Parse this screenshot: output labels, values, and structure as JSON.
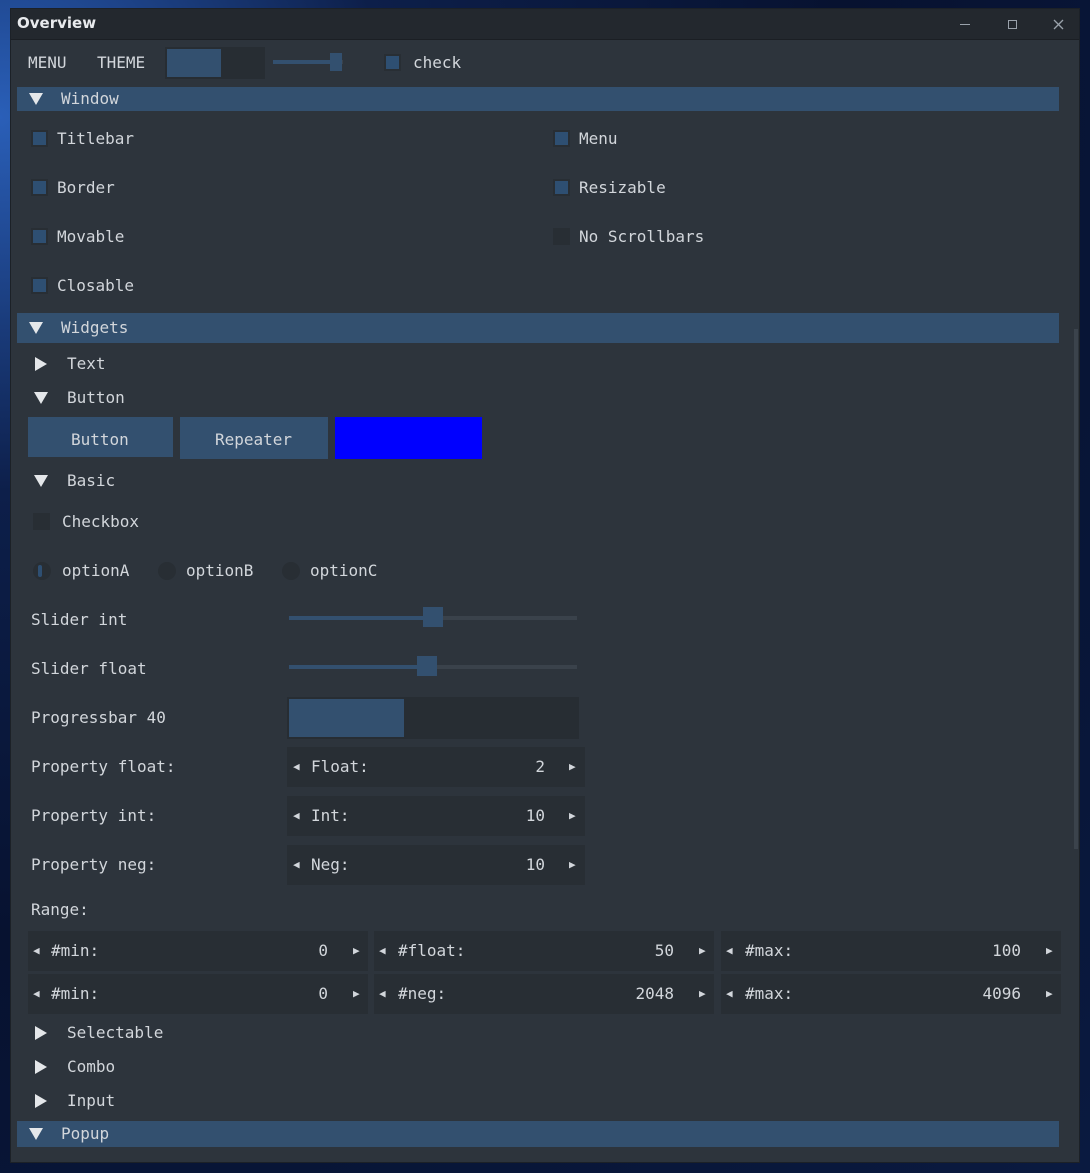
{
  "window": {
    "title": "Overview"
  },
  "menubar": {
    "menu": "MENU",
    "theme": "THEME",
    "check": "check",
    "slider_level": 0.9
  },
  "sections": {
    "window": "Window",
    "widgets": "Widgets",
    "popup": "Popup"
  },
  "window_flags": {
    "titlebar": "Titlebar",
    "menu": "Menu",
    "border": "Border",
    "resizable": "Resizable",
    "movable": "Movable",
    "no_scrollbars": "No Scrollbars",
    "closable": "Closable"
  },
  "widgets": {
    "text": "Text",
    "button_group": "Button",
    "buttons": {
      "button": "Button",
      "repeater": "Repeater",
      "color": "#0000ff"
    },
    "basic": "Basic",
    "checkbox": "Checkbox",
    "options": [
      "optionA",
      "optionB",
      "optionC"
    ],
    "slider_int_label": "Slider int",
    "slider_int_level": 0.5,
    "slider_float_label": "Slider float",
    "slider_float_level": 0.48,
    "progress_label": "Progressbar 40",
    "progress_value": 40,
    "prop_float_label": "Property float:",
    "prop_float": {
      "name": "Float:",
      "value": "2"
    },
    "prop_int_label": "Property int:",
    "prop_int": {
      "name": "Int:",
      "value": "10"
    },
    "prop_neg_label": "Property neg:",
    "prop_neg": {
      "name": "Neg:",
      "value": "10"
    },
    "range_label": "Range:",
    "range_row1": [
      {
        "name": "#min:",
        "value": "0"
      },
      {
        "name": "#float:",
        "value": "50"
      },
      {
        "name": "#max:",
        "value": "100"
      }
    ],
    "range_row2": [
      {
        "name": "#min:",
        "value": "0"
      },
      {
        "name": "#neg:",
        "value": "2048"
      },
      {
        "name": "#max:",
        "value": "4096"
      }
    ],
    "selectable": "Selectable",
    "combo": "Combo",
    "input": "Input"
  },
  "colors": {
    "accent": "#33506f",
    "panel": "#2d343c",
    "dark": "#282e34",
    "button_color": "#0000ff"
  }
}
